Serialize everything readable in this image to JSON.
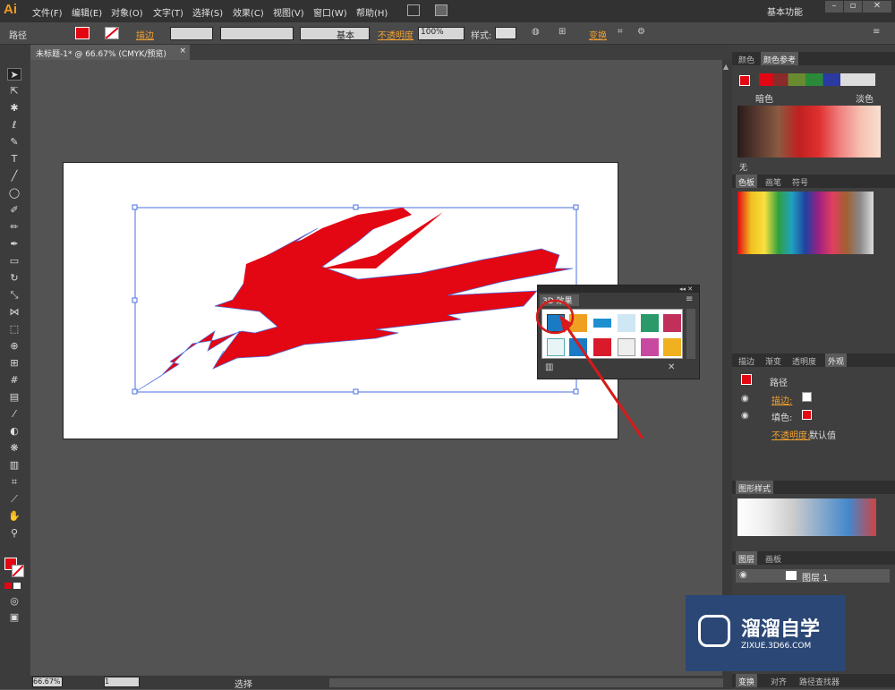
{
  "menu": {
    "logo": "Ai",
    "items": [
      "文件(F)",
      "编辑(E)",
      "对象(O)",
      "文字(T)",
      "选择(S)",
      "效果(C)",
      "视图(V)",
      "窗口(W)",
      "帮助(H)"
    ],
    "workspace": "基本功能",
    "window_controls": [
      "–",
      "▫",
      "✕"
    ]
  },
  "control": {
    "object_type": "路径",
    "stroke_label": "描边",
    "stroke_style": "基本",
    "opacity_label": "不透明度",
    "opacity_value": "100%",
    "style_label": "样式:",
    "transform_label": "变换"
  },
  "document": {
    "tab_title": "未标题-1* @ 66.67% (CMYK/预览)",
    "close": "×"
  },
  "status": {
    "zoom": "66.67%",
    "page": "1",
    "mode": "选择"
  },
  "colors": {
    "accent_red": "#e30613",
    "arrow_red": "#d81a1a"
  },
  "panel_color": {
    "tab1": "颜色",
    "tab2": "颜色参考",
    "darker": "暗色",
    "lighter": "淡色",
    "none_label": "无"
  },
  "panel_swatches": {
    "tab1": "色板",
    "tab2": "画笔",
    "tab3": "符号"
  },
  "panel_appearance": {
    "tab1": "描边",
    "tab2": "渐变",
    "tab3": "透明度",
    "tab4": "外观",
    "title": "路径",
    "stroke": "描边:",
    "fill": "填色:",
    "opacity": "不透明度:",
    "opacity_value": "默认值"
  },
  "panel_graphic_styles": {
    "title": "图形样式"
  },
  "panel_layers": {
    "tab1": "图层",
    "tab2": "画板",
    "layer_name": "图层 1"
  },
  "bottom_tabs": {
    "transform": "变换",
    "align": "对齐",
    "pathfinder": "路径查找器"
  },
  "panel_3d": {
    "title": "3D 效果"
  },
  "watermark": {
    "name": "溜溜自学",
    "url": "ZIXUE.3D66.COM"
  }
}
